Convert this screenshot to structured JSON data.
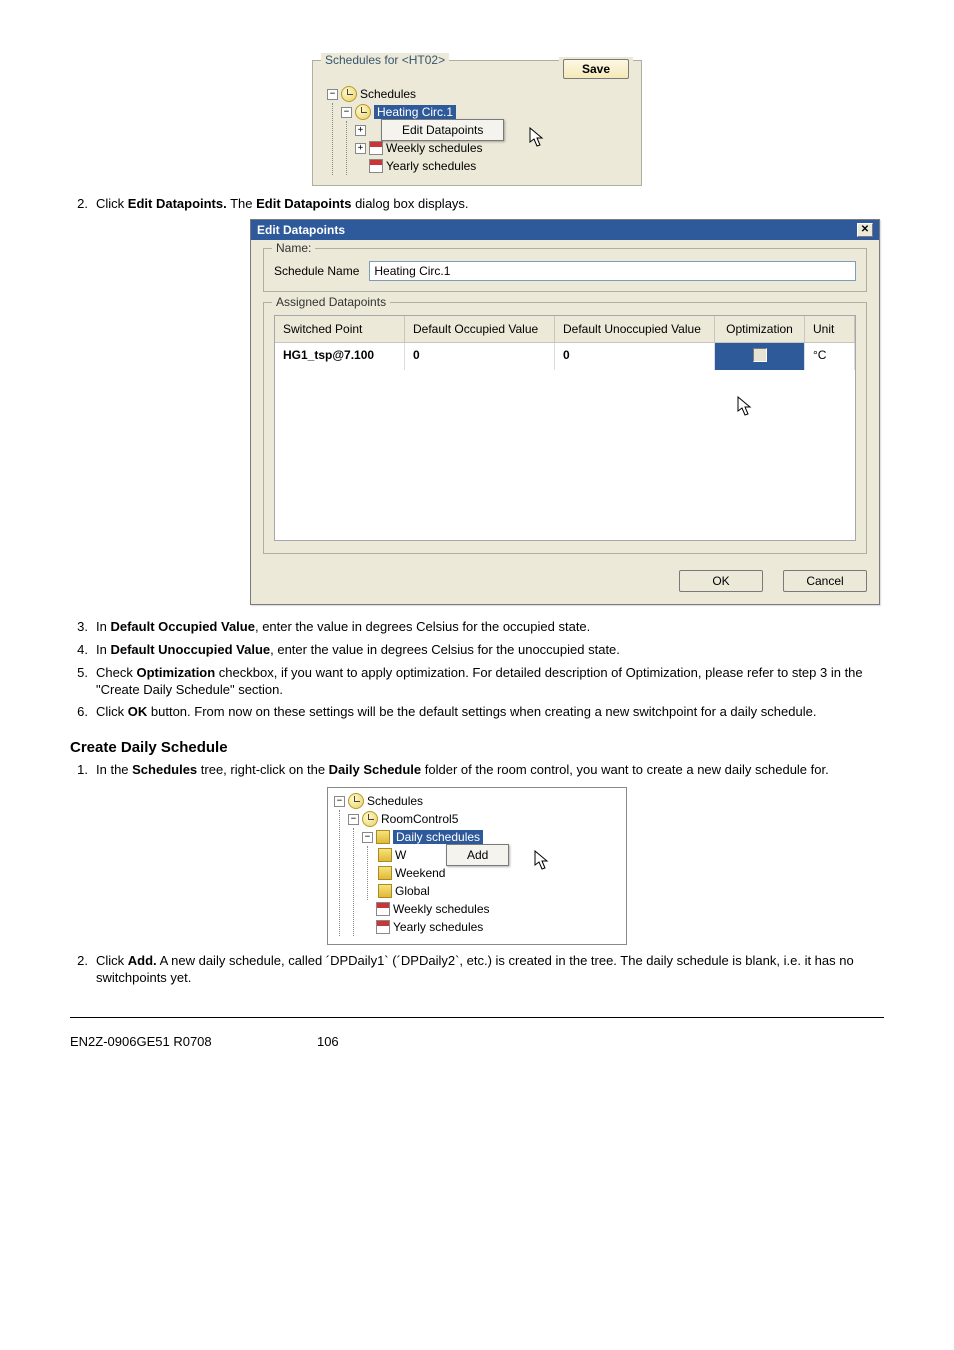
{
  "panel1": {
    "group_title": "Schedules for  <HT02>",
    "save_label": "Save",
    "root": "Schedules",
    "item_sel": "Heating Circ.1",
    "ctx_item": "Edit Datapoints",
    "weekly": "Weekly schedules",
    "yearly": "Yearly schedules"
  },
  "step2": {
    "num": "2.",
    "t1": "Click ",
    "b1": "Edit Datapoints.",
    "t2": " The ",
    "b2": "Edit Datapoints",
    "t3": " dialog box displays."
  },
  "dialog": {
    "title": "Edit Datapoints",
    "legend_name": "Name:",
    "lbl_schedule_name": "Schedule Name",
    "val_schedule_name": "Heating Circ.1",
    "legend_assigned": "Assigned Datapoints",
    "h_switched": "Switched Point",
    "h_occ": "Default Occupied Value",
    "h_unocc": "Default Unoccupied Value",
    "h_opt": "Optimization",
    "h_unit": "Unit",
    "r_point": "HG1_tsp@7.100",
    "r_occ": "0",
    "r_unocc": "0",
    "r_unit": "°C",
    "ok": "OK",
    "cancel": "Cancel"
  },
  "steps_mid": {
    "s3": {
      "num": "3.",
      "t1": "In ",
      "b1": "Default Occupied Value",
      "t2": ", enter the value in degrees Celsius for the occupied state."
    },
    "s4": {
      "num": "4.",
      "t1": "In ",
      "b1": "Default Unoccupied Value",
      "t2": ", enter the value in degrees Celsius for the unoccupied state."
    },
    "s5": {
      "num": "5.",
      "t1": "Check ",
      "b1": "Optimization",
      "t2": " checkbox, if you want to apply optimization. For detailed description of Optimization, please refer to step 3 in the \"Create Daily Schedule\" section."
    },
    "s6": {
      "num": "6.",
      "t1": "Click ",
      "b1": "OK",
      "t2": " button. From now on these settings will be the default settings when creating a new switchpoint for a daily schedule."
    }
  },
  "section_heading": "Create Daily Schedule",
  "steps_create": {
    "s1": {
      "num": "1.",
      "t1": "In the ",
      "b1": "Schedules",
      "t2": " tree, right-click on the ",
      "b2": "Daily Schedule",
      "t3": " folder of the room control, you want to create a new daily schedule for."
    },
    "s2": {
      "num": "2.",
      "t1": "Click ",
      "b1": "Add.",
      "t2": " A new daily schedule, called ´DPDaily1` (´DPDaily2`, etc.) is created in the tree. The daily schedule is blank, i.e. it has no switchpoints yet."
    }
  },
  "panel2": {
    "root": "Schedules",
    "room": "RoomControl5",
    "daily_sel": "Daily schedules",
    "add_ctx": "Add",
    "w": "W",
    "weekend": "Weekend",
    "global": "Global",
    "weekly": "Weekly schedules",
    "yearly": "Yearly schedules"
  },
  "footer": {
    "left": "EN2Z-0906GE51 R0708",
    "page": "106"
  }
}
